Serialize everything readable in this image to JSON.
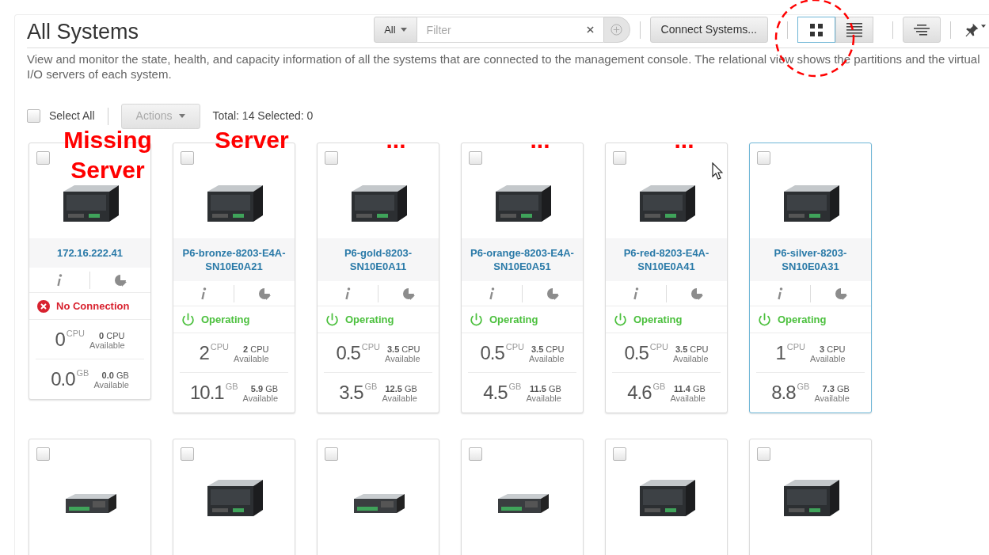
{
  "title": "All Systems",
  "filter": {
    "scope": "All",
    "placeholder": "Filter"
  },
  "connect_button": "Connect Systems...",
  "views": [
    {
      "kind": "grid",
      "selected": true
    },
    {
      "kind": "list",
      "selected": false
    }
  ],
  "description": "View and monitor the state, health, and capacity information of all the systems that are connected to the management console. The relational view shows the partitions and the virtual I/O servers of each system.",
  "select_all": {
    "label": "Select All",
    "checked": false
  },
  "actions_button": {
    "label": "Actions",
    "disabled": true
  },
  "summary": "Total: 14 Selected: 0",
  "systems": [
    {
      "annotation": "Missing Server",
      "name": "172.16.222.41",
      "checked": false,
      "selected": false,
      "status": {
        "kind": "error",
        "label": "No Connection"
      },
      "cpu_used": "0",
      "cpu_unit": "CPU",
      "cpu_available": "**0** CPU",
      "cpu_available_label": "Available",
      "mem_used": "0.0",
      "mem_unit": "GB",
      "mem_available": "**0.0** GB",
      "mem_available_label": "Available"
    },
    {
      "annotation": "Server",
      "name": "P6-bronze-8203-E4A-SN10E0A21",
      "checked": false,
      "selected": false,
      "status": {
        "kind": "operating",
        "label": "Operating"
      },
      "cpu_used": "2",
      "cpu_unit": "CPU",
      "cpu_available": "**2** CPU",
      "cpu_available_label": "Available",
      "mem_used": "10.1",
      "mem_unit": "GB",
      "mem_available": "**5.9** GB",
      "mem_available_label": "Available"
    },
    {
      "annotation": "...",
      "name": "P6-gold-8203-SN10E0A11",
      "checked": false,
      "selected": false,
      "status": {
        "kind": "operating",
        "label": "Operating"
      },
      "cpu_used": "0.5",
      "cpu_unit": "CPU",
      "cpu_available": "**3.5** CPU",
      "cpu_available_label": "Available",
      "mem_used": "3.5",
      "mem_unit": "GB",
      "mem_available": "**12.5** GB",
      "mem_available_label": "Available"
    },
    {
      "annotation": "...",
      "name": "P6-orange-8203-E4A-SN10E0A51",
      "checked": false,
      "selected": false,
      "status": {
        "kind": "operating",
        "label": "Operating"
      },
      "cpu_used": "0.5",
      "cpu_unit": "CPU",
      "cpu_available": "**3.5** CPU",
      "cpu_available_label": "Available",
      "mem_used": "4.5",
      "mem_unit": "GB",
      "mem_available": "**11.5** GB",
      "mem_available_label": "Available"
    },
    {
      "annotation": "...",
      "name": "P6-red-8203-E4A-SN10E0A41",
      "checked": false,
      "selected": false,
      "status": {
        "kind": "operating",
        "label": "Operating"
      },
      "cpu_used": "0.5",
      "cpu_unit": "CPU",
      "cpu_available": "**3.5** CPU",
      "cpu_available_label": "Available",
      "mem_used": "4.6",
      "mem_unit": "GB",
      "mem_available": "**11.4** GB",
      "mem_available_label": "Available"
    },
    {
      "name": "P6-silver-8203-SN10E0A31",
      "checked": false,
      "selected": true,
      "status": {
        "kind": "operating",
        "label": "Operating"
      },
      "cpu_used": "1",
      "cpu_unit": "CPU",
      "cpu_available": "**3** CPU",
      "cpu_available_label": "Available",
      "mem_used": "8.8",
      "mem_unit": "GB",
      "mem_available": "**7.3** GB",
      "mem_available_label": "Available"
    }
  ],
  "more_systems": [
    {
      "kind": "slim",
      "checked": false
    },
    {
      "kind": "tall",
      "checked": false
    },
    {
      "kind": "slim",
      "checked": false
    },
    {
      "kind": "slim",
      "checked": false
    },
    {
      "kind": "tall",
      "checked": false
    },
    {
      "kind": "tall",
      "checked": false
    }
  ]
}
